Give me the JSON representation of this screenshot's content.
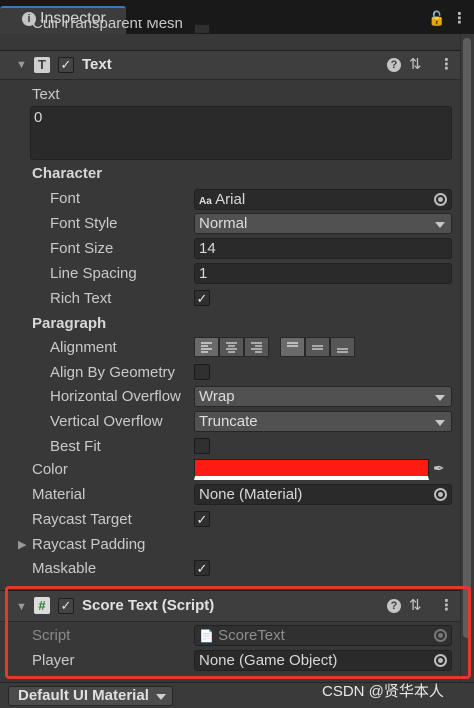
{
  "tab": {
    "icon": "info-icon",
    "label": "Inspector"
  },
  "partial_row": "Cull Transparent Mesh",
  "text_component": {
    "title": "Text",
    "enabled": true,
    "text_label": "Text",
    "text_value": "0",
    "character_section": "Character",
    "font_label": "Font",
    "font_prefix": "Aa",
    "font_value": "Arial",
    "font_style_label": "Font Style",
    "font_style_value": "Normal",
    "font_size_label": "Font Size",
    "font_size_value": "14",
    "line_spacing_label": "Line Spacing",
    "line_spacing_value": "1",
    "rich_text_label": "Rich Text",
    "rich_text_checked": true,
    "paragraph_section": "Paragraph",
    "alignment_label": "Alignment",
    "align_geometry_label": "Align By Geometry",
    "align_geometry_checked": false,
    "h_overflow_label": "Horizontal Overflow",
    "h_overflow_value": "Wrap",
    "v_overflow_label": "Vertical Overflow",
    "v_overflow_value": "Truncate",
    "best_fit_label": "Best Fit",
    "best_fit_checked": false,
    "color_label": "Color",
    "color_value": "#ff1a12",
    "material_label": "Material",
    "material_value": "None (Material)",
    "raycast_target_label": "Raycast Target",
    "raycast_target_checked": true,
    "raycast_padding_label": "Raycast Padding",
    "maskable_label": "Maskable",
    "maskable_checked": true
  },
  "score_component": {
    "title": "Score Text (Script)",
    "enabled": true,
    "script_label": "Script",
    "script_value": "ScoreText",
    "player_label": "Player",
    "player_value": "None (Game Object)"
  },
  "bottom": {
    "material_dropdown": "Default UI Material"
  },
  "watermark": "CSDN @贤华本人",
  "colors": {
    "highlight": "#e03a2e",
    "accent_tab": "#3a79bb",
    "text_color": "#ff1a12"
  }
}
